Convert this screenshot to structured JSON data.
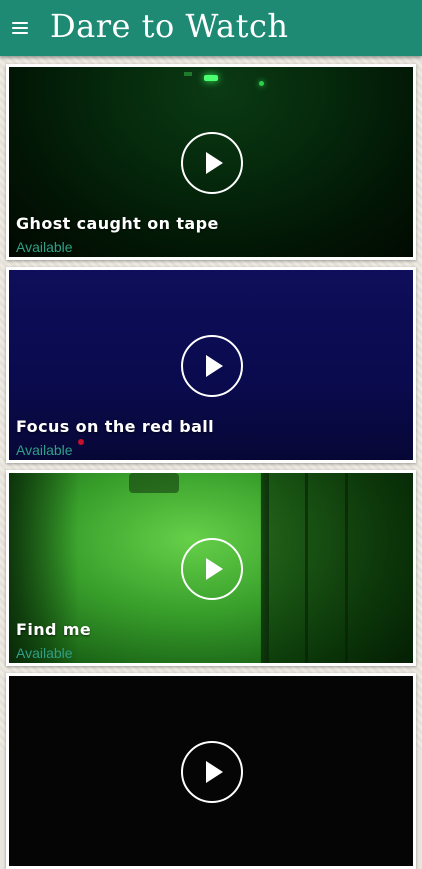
{
  "header": {
    "menu_icon": "hamburger-menu-icon",
    "title": "Dare to Watch",
    "background": "#1f8a74"
  },
  "videos": [
    {
      "title": "Ghost caught on tape",
      "status": "Available",
      "play_icon": "play-icon"
    },
    {
      "title": "Focus on the red ball",
      "status": "Available",
      "play_icon": "play-icon"
    },
    {
      "title": "Find me",
      "status": "Available",
      "play_icon": "play-icon"
    },
    {
      "title": "",
      "status": "",
      "play_icon": "play-icon"
    }
  ],
  "colors": {
    "accent": "#1f8a74",
    "status_text": "#2fa087"
  }
}
